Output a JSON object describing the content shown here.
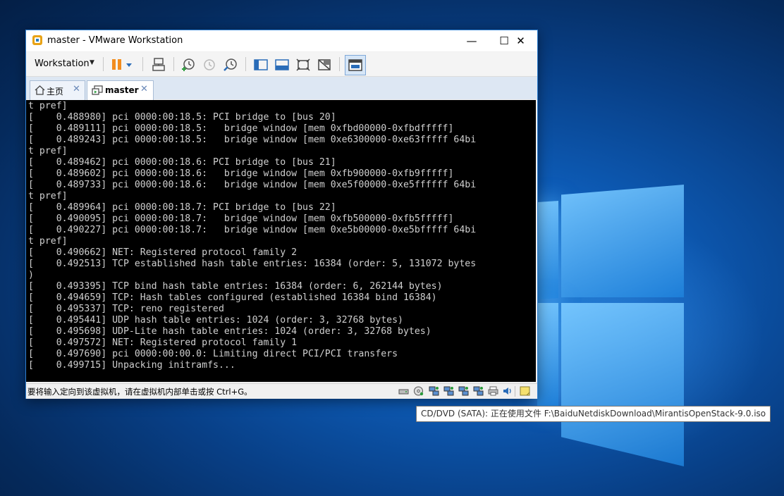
{
  "window": {
    "title": "master - VMware Workstation",
    "controls": {
      "minimize": "—",
      "maximize": "☐",
      "close": "✕"
    }
  },
  "toolbar": {
    "workstation_menu": "Workstation",
    "icons": [
      "pause-icon",
      "dropdown-caret-icon",
      "send-ctrl-alt-del-icon",
      "snapshot-take-icon",
      "snapshot-revert-icon",
      "snapshot-manager-icon",
      "sidebar-toggle-icon",
      "console-view-icon",
      "fullscreen-icon",
      "unity-icon",
      "thumbnail-view-icon"
    ]
  },
  "tabs": [
    {
      "label": "主页",
      "icon": "home-icon",
      "active": false
    },
    {
      "label": "master",
      "icon": "vm-icon",
      "active": true
    }
  ],
  "console": {
    "lines": [
      "t pref]",
      "[    0.488980] pci 0000:00:18.5: PCI bridge to [bus 20]",
      "[    0.489111] pci 0000:00:18.5:   bridge window [mem 0xfbd00000-0xfbdfffff]",
      "[    0.489243] pci 0000:00:18.5:   bridge window [mem 0xe6300000-0xe63fffff 64bi",
      "t pref]",
      "[    0.489462] pci 0000:00:18.6: PCI bridge to [bus 21]",
      "[    0.489602] pci 0000:00:18.6:   bridge window [mem 0xfb900000-0xfb9fffff]",
      "[    0.489733] pci 0000:00:18.6:   bridge window [mem 0xe5f00000-0xe5ffffff 64bi",
      "t pref]",
      "[    0.489964] pci 0000:00:18.7: PCI bridge to [bus 22]",
      "[    0.490095] pci 0000:00:18.7:   bridge window [mem 0xfb500000-0xfb5fffff]",
      "[    0.490227] pci 0000:00:18.7:   bridge window [mem 0xe5b00000-0xe5bfffff 64bi",
      "t pref]",
      "[    0.490662] NET: Registered protocol family 2",
      "[    0.492513] TCP established hash table entries: 16384 (order: 5, 131072 bytes",
      ")",
      "[    0.493395] TCP bind hash table entries: 16384 (order: 6, 262144 bytes)",
      "[    0.494659] TCP: Hash tables configured (established 16384 bind 16384)",
      "[    0.495337] TCP: reno registered",
      "[    0.495441] UDP hash table entries: 1024 (order: 3, 32768 bytes)",
      "[    0.495698] UDP-Lite hash table entries: 1024 (order: 3, 32768 bytes)",
      "[    0.497572] NET: Registered protocol family 1",
      "[    0.497690] pci 0000:00:00.0: Limiting direct PCI/PCI transfers",
      "[    0.499715] Unpacking initramfs..."
    ]
  },
  "statusbar": {
    "text": "要将输入定向到该虚拟机，请在虚拟机内部单击或按 Ctrl+G。",
    "device_icons": [
      "hard-disk-icon",
      "cd-dvd-icon",
      "network-adapter-icon",
      "network-adapter-icon",
      "network-adapter-icon",
      "network-adapter-icon",
      "printer-icon",
      "sound-card-icon",
      "message-log-icon"
    ]
  },
  "tooltip": {
    "text": "CD/DVD (SATA): 正在使用文件 F:\\BaiduNetdiskDownload\\MirantisOpenStack-9.0.iso"
  },
  "colors": {
    "accent": "#2f7fd0",
    "console_bg": "#000000",
    "console_text": "#cfcfcf",
    "pause_orange": "#f28c1e"
  }
}
